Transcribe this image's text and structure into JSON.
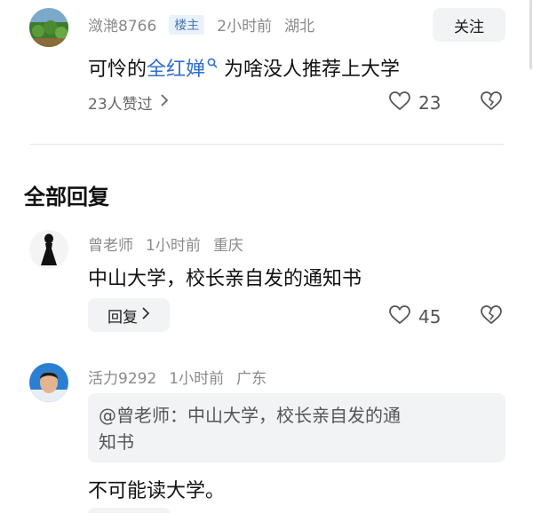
{
  "post": {
    "username": "潋滟8766",
    "badge": "楼主",
    "time": "2小时前",
    "location": "湖北",
    "follow_label": "关注",
    "text_before": "可怜的",
    "linked_name": "全红婵",
    "text_after": " 为啥没人推荐上大学",
    "likes_summary": "23人赞过",
    "like_count": "23"
  },
  "section": {
    "title": "全部回复"
  },
  "replies": [
    {
      "username": "曾老师",
      "time": "1小时前",
      "location": "重庆",
      "text": "中山大学，校长亲自发的通知书",
      "reply_label": "回复",
      "like_count": "45"
    },
    {
      "username": "活力9292",
      "time": "1小时前",
      "location": "广东",
      "quote_line1": "@曾老师：中山大学，校长亲自发的通",
      "quote_line2": "知书",
      "text": "不可能读大学。"
    }
  ],
  "colors": {
    "link": "#2f6ed1",
    "meta_gray": "#8a8a8a",
    "button_bg": "#f2f3f5",
    "badge_bg": "#e9f1fb",
    "badge_text": "#4a79b8"
  },
  "icons": [
    "heart-icon",
    "broken-heart-icon",
    "chevron-right-icon",
    "search-icon"
  ]
}
